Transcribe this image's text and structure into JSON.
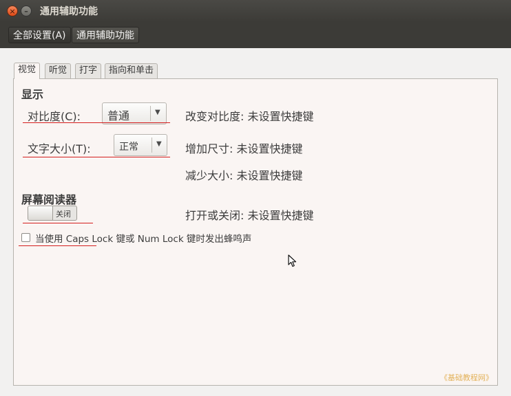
{
  "window": {
    "title": "通用辅助功能"
  },
  "toolbar": {
    "all_settings": "全部设置(A)",
    "current": "通用辅助功能"
  },
  "tabs": [
    {
      "label": "视觉",
      "active": true
    },
    {
      "label": "听觉",
      "active": false
    },
    {
      "label": "打字",
      "active": false
    },
    {
      "label": "指向和单击",
      "active": false
    }
  ],
  "display": {
    "heading": "显示",
    "contrast_label": "对比度(C):",
    "contrast_value": "普通",
    "text_size_label": "文字大小(T):",
    "text_size_value": "正常"
  },
  "shortcuts": {
    "contrast": "改变对比度:  未设置快捷键",
    "increase": "增加尺寸:  未设置快捷键",
    "decrease": "减少大小:  未设置快捷键",
    "screen_reader": "打开或关闭:  未设置快捷键"
  },
  "screen_reader": {
    "heading": "屏幕阅读器",
    "switch_state": "关闭",
    "enabled": false
  },
  "beep": {
    "label": "当使用 Caps Lock 键或 Num Lock 键时发出蜂鸣声",
    "checked": false
  },
  "watermark": "《基础教程网》",
  "colors": {
    "titlebar": "#3c3b37",
    "page_bg": "#faf5f3",
    "close_button": "#df4a16",
    "underline": "#d41c1c",
    "watermark": "#e3b25a"
  }
}
